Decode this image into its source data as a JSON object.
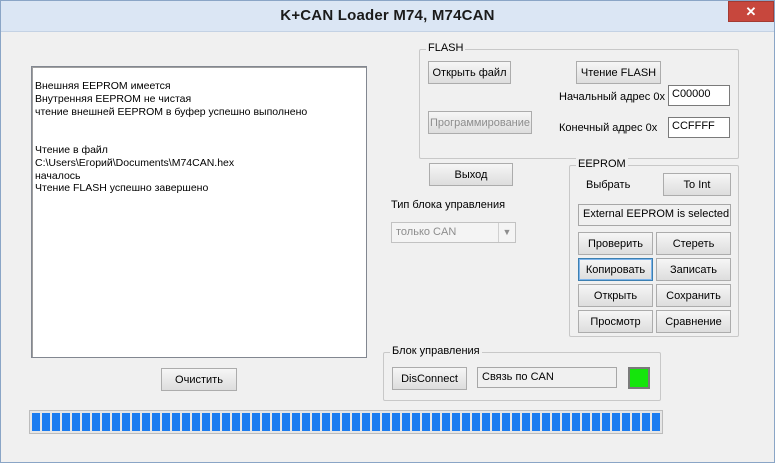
{
  "window": {
    "title": "K+CAN Loader M74, M74CAN",
    "close_glyph": "✕"
  },
  "log": {
    "lines": [
      "Внешняя EEPROM имеется",
      "Внутренняя EEPROM не чистая",
      "чтение внешней EEPROM в буфер успешно выполнено",
      "",
      "",
      "Чтение в файл",
      "C:\\Users\\Егорий\\Documents\\M74CAN.hex",
      "началось",
      "Чтение FLASH успешно завершено"
    ]
  },
  "clear_button": "Очистить",
  "flash": {
    "group_label": "FLASH",
    "open_file_button": "Открыть файл",
    "read_flash_button": "Чтение FLASH",
    "program_button": "Программирование",
    "start_address_label": "Начальный адрес 0x",
    "start_address_value": "C00000",
    "end_address_label": "Конечный адрес  0x",
    "end_address_value": "CCFFFF"
  },
  "exit_button": "Выход",
  "ecu_type": {
    "label": "Тип блока управления",
    "selected": "только CAN"
  },
  "eeprom": {
    "group_label": "EEPROM",
    "select_label": "Выбрать",
    "to_int_button": "To Int",
    "status": "External EEPROM is selected",
    "check_button": "Проверить",
    "erase_button": "Стереть",
    "copy_button": "Копировать",
    "write_button": "Записать",
    "open_button": "Открыть",
    "save_button": "Сохранить",
    "view_button": "Просмотр",
    "compare_button": "Сравнение"
  },
  "ecu": {
    "group_label": "Блок управления",
    "disconnect_button": "DisConnect",
    "connection_status": "Связь по CAN",
    "led_color": "#15e50c"
  },
  "progress": {
    "percent": 100,
    "color": "#1b7cf0"
  }
}
